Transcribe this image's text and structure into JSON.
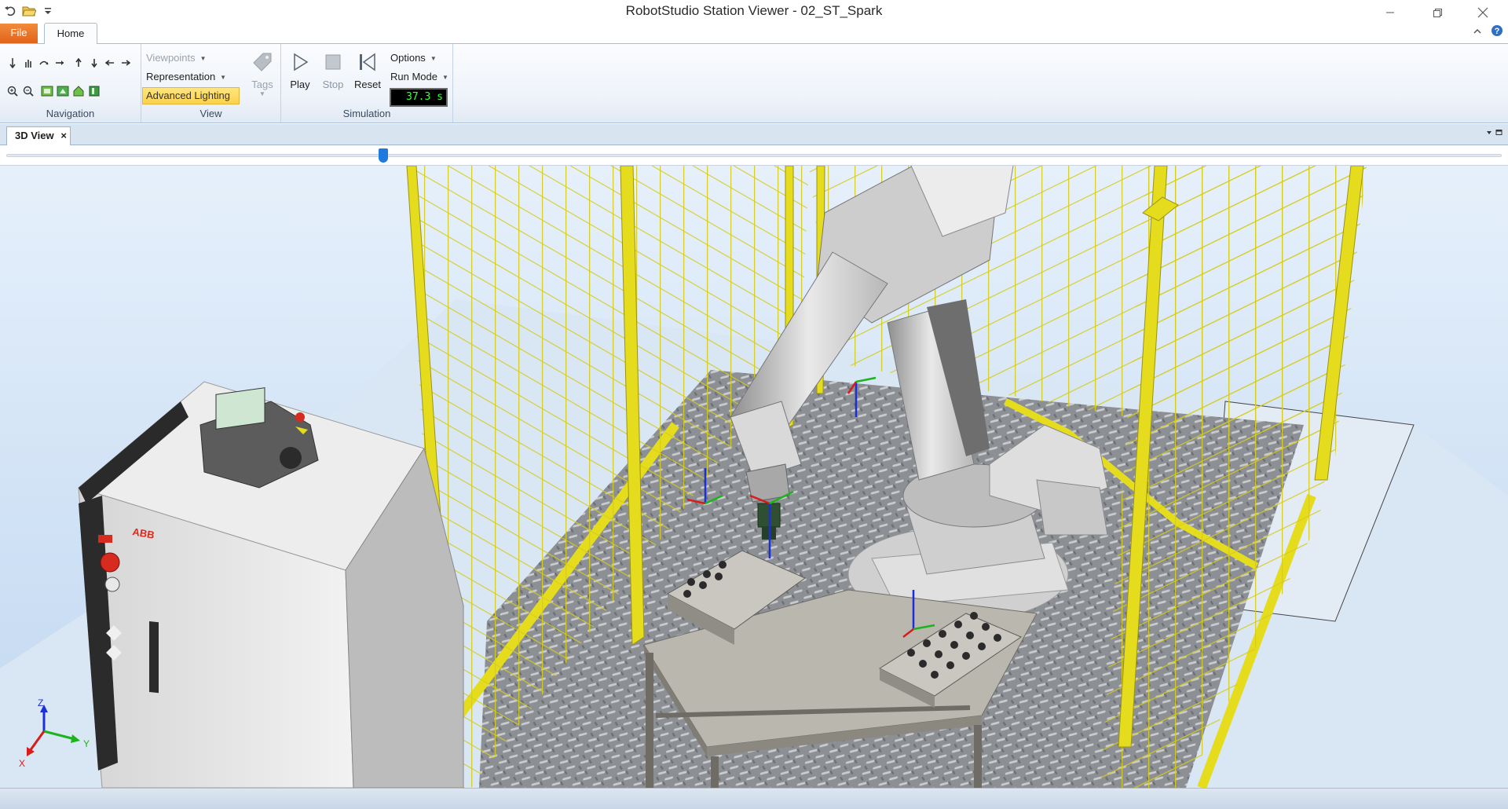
{
  "window": {
    "title": "RobotStudio Station Viewer - 02_ST_Spark"
  },
  "quick_access": [
    "undo-icon",
    "open-folder-icon",
    "customize-icon"
  ],
  "tabs": {
    "file": "File",
    "home": "Home"
  },
  "ribbon": {
    "navigation": {
      "label": "Navigation",
      "icons_row1": [
        "select-icon",
        "pan-icon",
        "rotate-icon",
        "look-around-icon",
        "move-up-icon",
        "move-down-icon",
        "move-left-icon",
        "move-right-icon"
      ],
      "icons_row2": [
        "zoom-in-icon",
        "zoom-out-icon",
        "view-all-icon",
        "view-center-icon",
        "home-view-icon",
        "layout-icon"
      ]
    },
    "view": {
      "label": "View",
      "viewpoints": "Viewpoints",
      "representation": "Representation",
      "advanced_lighting": "Advanced Lighting",
      "tags": "Tags"
    },
    "simulation": {
      "label": "Simulation",
      "play": "Play",
      "stop": "Stop",
      "reset": "Reset",
      "options": "Options",
      "run_mode": "Run Mode",
      "time": "37.3 s"
    }
  },
  "document": {
    "tab": "3D View",
    "close": "×"
  },
  "timeline": {
    "position": 0.252
  },
  "axes": {
    "x": "X",
    "y": "Y",
    "z": "Z"
  },
  "controller_brand": "ABB",
  "colors": {
    "fence": "#e6dc1e",
    "file_tab": "#ea7227",
    "lighting_highlight": "#fcd24a",
    "timer_text": "#3cff3c"
  }
}
